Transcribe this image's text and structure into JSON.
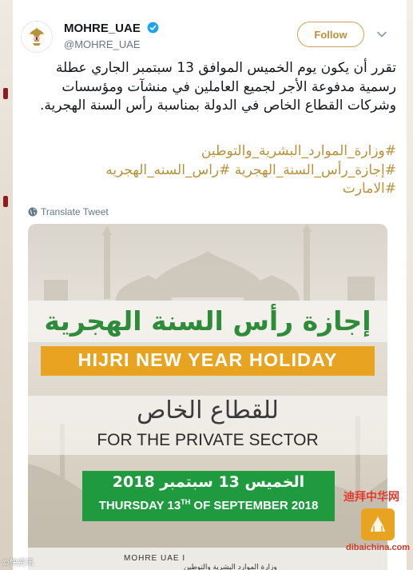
{
  "account": {
    "display_name": "MOHRE_UAE",
    "handle": "@MOHRE_UAE",
    "follow_label": "Follow",
    "verified": true
  },
  "tweet": {
    "text": "تقرر أن يكون يوم الخميس الموافق 13 سبتمبر الجاري عطلة رسمية مدفوعة الأجر لجميع العاملين في منشآت ومؤسسات وشركات القطاع الخاص في الدولة بمناسبة رأس السنة الهجرية.",
    "hashtags": [
      "#وزارة_الموارد_البشرية_والتوطين",
      "#إجازة_رأس_السنة_الهجرية #راس_السنه_الهجريه",
      "#الامارت"
    ],
    "translate_label": "Translate Tweet"
  },
  "media": {
    "title_ar": "إجازة رأس السنة الهجرية",
    "title_en": "HIJRI NEW YEAR HOLIDAY",
    "subtitle_ar": "للقطاع الخاص",
    "subtitle_en": "FOR THE PRIVATE SECTOR",
    "date_ar": "الخميس 13 سبتمبر 2018",
    "date_en_prefix": "THURSDAY 13",
    "date_en_sup": "TH",
    "date_en_suffix": " OF SEPTEMBER 2018",
    "footer_brand": "MOHRE UAE  I",
    "footer_ar": "وزارة الموارد البشرية والتوطين"
  },
  "watermarks": {
    "left": "©快资讯",
    "right_cn": "迪拜中华网",
    "right_url": "dibaichina.com"
  },
  "colors": {
    "accent_gold": "#b8923a",
    "banner_gold": "#e8a321",
    "title_green": "#2e8b3a",
    "date_green": "#1f9a3f",
    "verified_blue": "#1da1f2"
  },
  "icons": [
    "uae-emblem-icon",
    "verified-icon",
    "chevron-down-icon",
    "globe-icon"
  ]
}
